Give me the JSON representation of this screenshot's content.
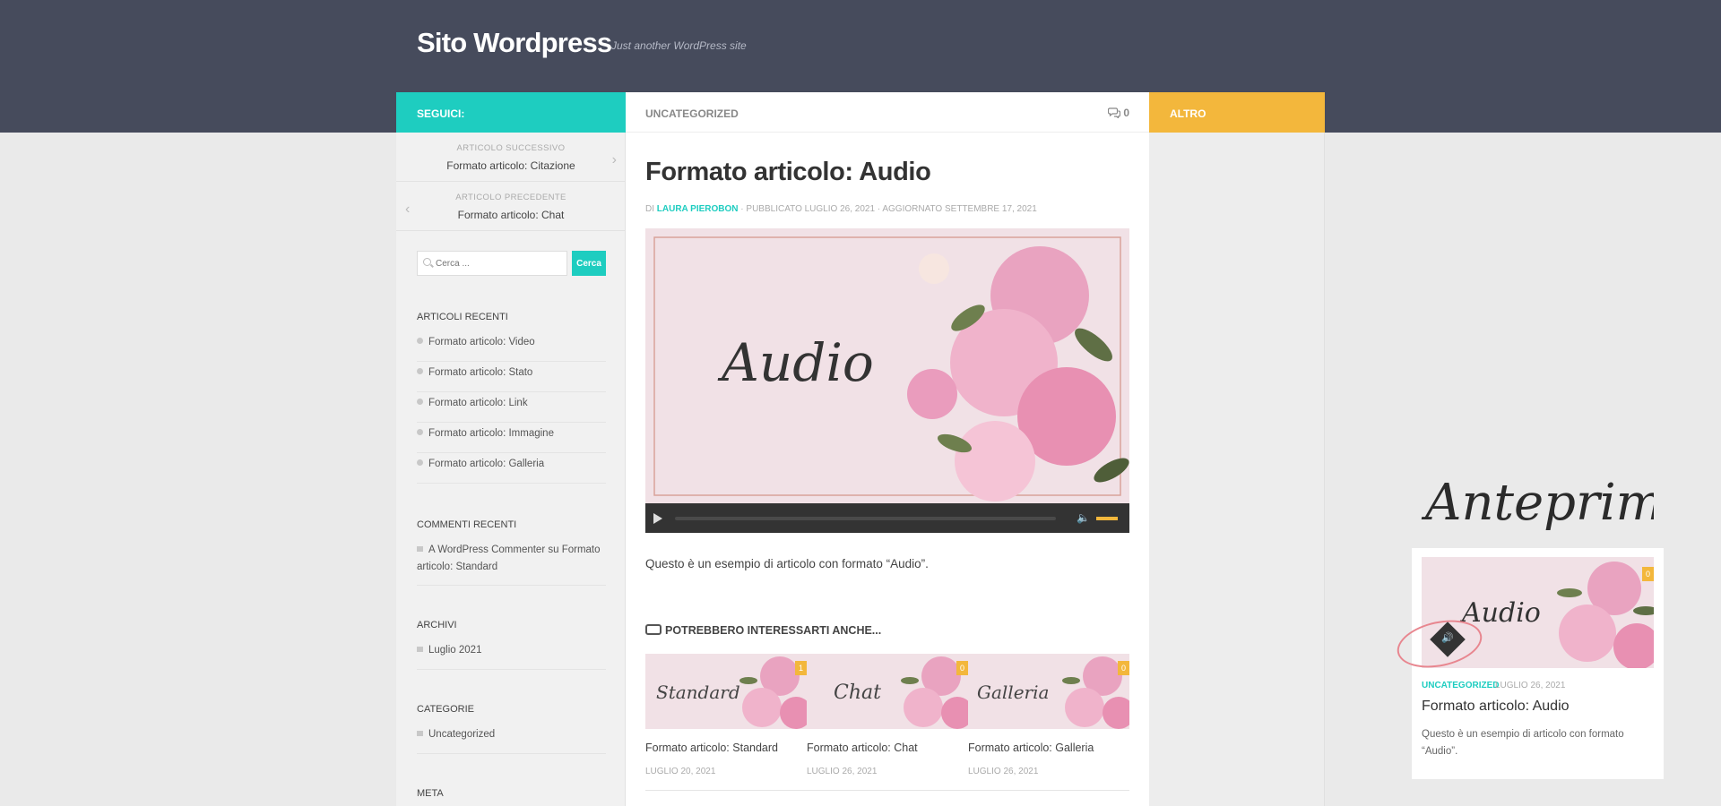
{
  "site": {
    "title": "Sito Wordpress",
    "tagline": "Just another WordPress site"
  },
  "header_bar": {
    "seguici": "SEGUICI:",
    "category": "UNCATEGORIZED",
    "comment_count": "0",
    "altro": "ALTRO"
  },
  "post_nav": {
    "next_label": "ARTICOLO SUCCESSIVO",
    "next_title": "Formato articolo: Citazione",
    "prev_label": "ARTICOLO PRECEDENTE",
    "prev_title": "Formato articolo: Chat"
  },
  "search": {
    "placeholder": "Cerca ...",
    "button": "Cerca"
  },
  "widgets": {
    "recent_posts": {
      "title": "ARTICOLI RECENTI",
      "items": [
        "Formato articolo: Video",
        "Formato articolo: Stato",
        "Formato articolo: Link",
        "Formato articolo: Immagine",
        "Formato articolo: Galleria"
      ]
    },
    "recent_comments": {
      "title": "COMMENTI RECENTI",
      "line1": "A WordPress Commenter su Formato",
      "line2": "articolo: Standard"
    },
    "archives": {
      "title": "ARCHIVI",
      "item": "Luglio 2021"
    },
    "categories": {
      "title": "CATEGORIE",
      "item": "Uncategorized"
    },
    "meta": {
      "title": "META"
    }
  },
  "post": {
    "title": "Formato articolo: Audio",
    "meta_prefix": "DI ",
    "author": "LAURA PIEROBON",
    "meta_suffix": " · PUBBLICATO LUGLIO 26, 2021 · AGGIORNATO SETTEMBRE 17, 2021",
    "hero_script": "Audio",
    "player": {
      "progress": 0,
      "volume": 1.0
    },
    "excerpt": "Questo è un esempio di articolo con formato “Audio”."
  },
  "related": {
    "heading": "POTREBBERO INTERESSARTI ANCHE...",
    "items": [
      {
        "script": "Standard",
        "comments": "1",
        "title": "Formato articolo: Standard",
        "date": "LUGLIO 20, 2021"
      },
      {
        "script": "Chat",
        "comments": "0",
        "title": "Formato articolo: Chat",
        "date": "LUGLIO 26, 2021"
      },
      {
        "script": "Galleria",
        "comments": "0",
        "title": "Formato articolo: Galleria",
        "date": "LUGLIO 26, 2021"
      }
    ]
  },
  "preview": {
    "script_word": "Anteprima",
    "thumb_script": "Audio",
    "comments": "0",
    "category": "UNCATEGORIZED",
    "date": "LUGLIO 26, 2021",
    "title": "Formato articolo: Audio",
    "excerpt": "Questo è un esempio di articolo con formato “Audio”."
  },
  "colors": {
    "header_bg": "#464b5c",
    "teal": "#1ecdc0",
    "yellow": "#f3b73c",
    "pink_bg": "#f1e1e6"
  },
  "icons": {
    "comment": "comment-bubble-icon",
    "audio": "speaker-icon",
    "related": "hand-point-icon"
  }
}
